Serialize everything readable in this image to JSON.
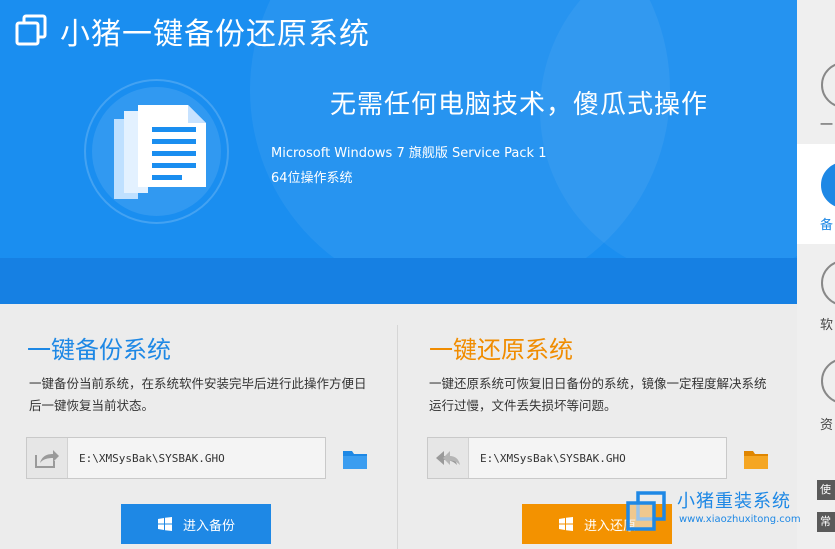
{
  "app": {
    "title": "小猪一键备份还原系统",
    "logo_icon": "app-logo-icon"
  },
  "banner": {
    "slogan": "无需任何电脑技术，傻瓜式操作",
    "os_name": "Microsoft Windows 7 旗舰版 Service Pack 1",
    "os_bits": "64位操作系统",
    "icon": "document-icon"
  },
  "backup": {
    "title": "一键备份系统",
    "description": "一键备份当前系统，在系统软件安装完毕后进行此操作方便日后一键恢复当前状态。",
    "path_value": "E:\\XMSysBak\\SYSBAK.GHO",
    "path_icon": "export-arrow-icon",
    "browse_icon": "folder-icon",
    "button_label": "进入备份",
    "button_icon": "windows-logo-icon"
  },
  "restore": {
    "title": "一键还原系统",
    "description": "一键还原系统可恢复旧日备份的系统，镜像一定程度解决系统运行过慢，文件丢失损坏等问题。",
    "path_value": "E:\\XMSysBak\\SYSBAK.GHO",
    "path_icon": "double-back-arrow-icon",
    "browse_icon": "folder-icon",
    "button_label": "进入还原",
    "button_icon": "windows-logo-icon"
  },
  "sidebar": {
    "items": [
      {
        "label": "一",
        "active": false
      },
      {
        "label": "备",
        "active": true
      },
      {
        "label": "软",
        "active": false
      },
      {
        "label": "资",
        "active": false
      }
    ],
    "tags": [
      "使",
      "常"
    ]
  },
  "watermark": {
    "title": "小猪重装系统",
    "url": "www.xiaozhuxitong.com"
  },
  "colors": {
    "header_blue": "#1a8ef0",
    "backup_accent": "#1e88e5",
    "restore_accent": "#f39200",
    "folder_blue": "#1e88e5",
    "folder_orange": "#f39200"
  }
}
